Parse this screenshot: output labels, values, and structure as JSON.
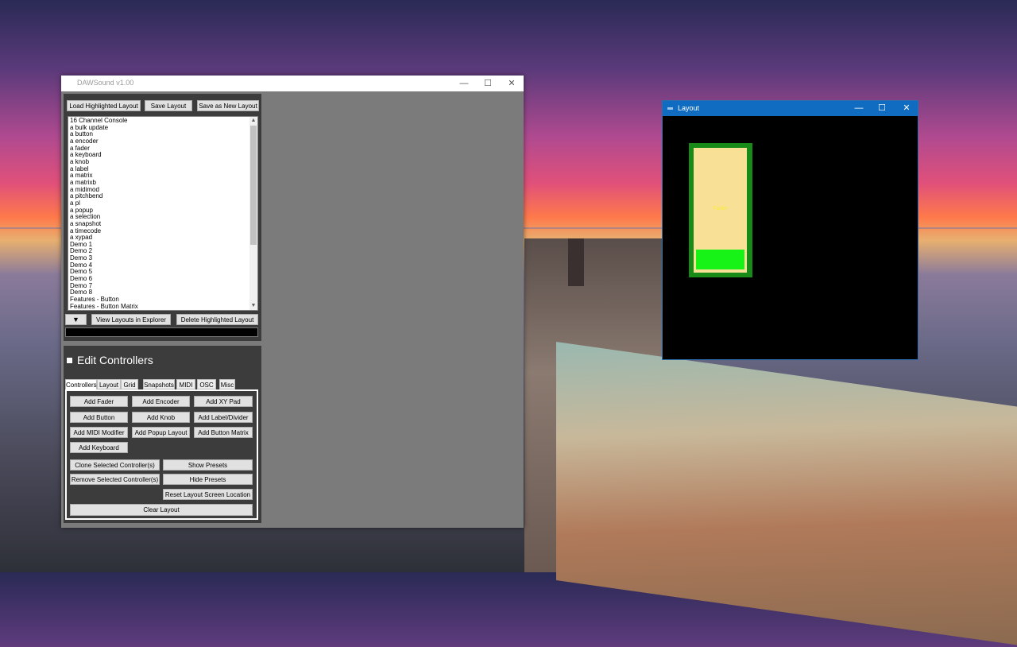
{
  "main_window": {
    "title": "DAWSound  v1.00",
    "controls": {
      "minimize": "—",
      "maximize": "☐",
      "close": "✕"
    }
  },
  "layout_file_buttons": {
    "load": "Load Highlighted Layout",
    "save": "Save Layout",
    "save_new": "Save as New Layout"
  },
  "layout_list": {
    "items": [
      "16 Channel Console",
      "a bulk update",
      "a button",
      "a encoder",
      "a fader",
      "a keyboard",
      "a knob",
      "a label",
      "a matrix",
      "a matrixb",
      "a midimod",
      "a pitchbend",
      "a pl",
      "a popup",
      "a selection",
      "a snapshot",
      "a timecode",
      "a xypad",
      "Demo 1",
      "Demo 2",
      "Demo 3",
      "Demo 4",
      "Demo 5",
      "Demo 6",
      "Demo 7",
      "Demo 8",
      "Features - Button",
      "Features - Button Matrix"
    ]
  },
  "list_actions": {
    "dropdown_glyph": "▼",
    "view_explorer": "View Layouts in Explorer",
    "delete": "Delete Highlighted Layout"
  },
  "edit_controllers": {
    "title": "Edit Controllers",
    "tabs": [
      "Controllers",
      "Layout",
      "Grid",
      "Snapshots",
      "MIDI",
      "OSC",
      "Misc"
    ],
    "active_tab": "Controllers",
    "buttons": {
      "add_fader": "Add Fader",
      "add_encoder": "Add Encoder",
      "add_xy_pad": "Add XY Pad",
      "add_button": "Add Button",
      "add_knob": "Add Knob",
      "add_label_divider": "Add Label/Divider",
      "add_midi_modifier": "Add MIDI Modifier",
      "add_popup_layout": "Add Popup Layout",
      "add_button_matrix": "Add Button Matrix",
      "add_keyboard": "Add Keyboard",
      "clone_selected": "Clone Selected Controller(s)",
      "show_presets": "Show Presets",
      "remove_selected": "Remove Selected Controller(s)",
      "hide_presets": "Hide Presets",
      "reset_location": "Reset Layout Screen Location",
      "clear_layout": "Clear Layout"
    }
  },
  "layout_window": {
    "title": "Layout",
    "fader_label": "Fader",
    "fader_level": 0.14,
    "colors": {
      "frame": "#178a17",
      "track": "#f8e096",
      "fill": "#17f217"
    }
  }
}
